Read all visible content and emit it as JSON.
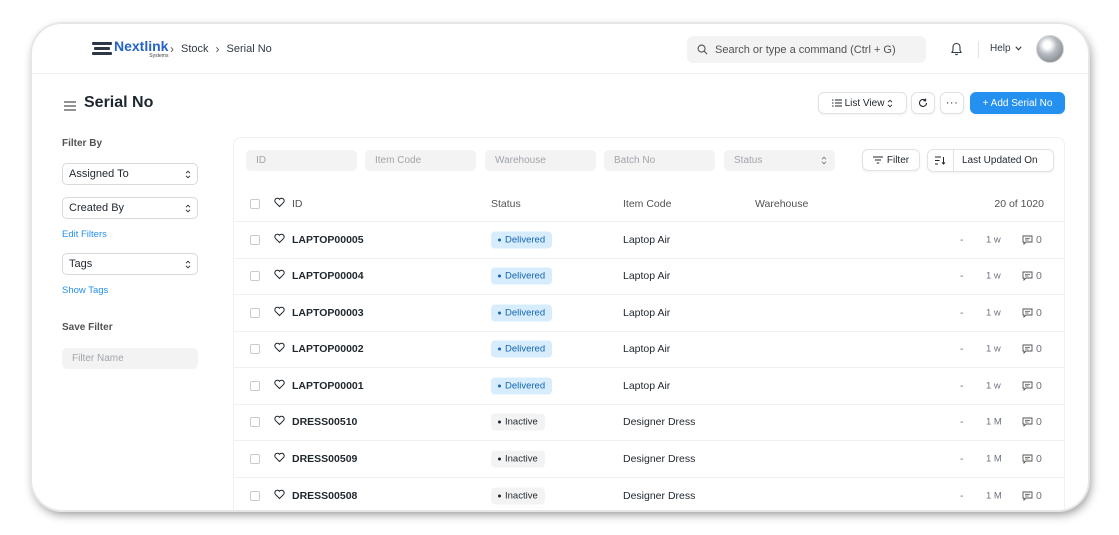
{
  "navbar": {
    "logo_text": "Nextlink",
    "logo_sub": "Systems",
    "breadcrumbs": [
      "Stock",
      "Serial No"
    ],
    "search_placeholder": "Search or type a command (Ctrl + G)",
    "help_label": "Help",
    "icons": {
      "search": "search-icon",
      "bell": "bell-icon",
      "chevron": "chevron-down-icon"
    }
  },
  "page": {
    "title": "Serial No",
    "list_view_label": "List View",
    "more_label": "···",
    "add_label": "+ Add Serial No",
    "accent_color": "#2490ef"
  },
  "sidebar": {
    "filter_by_label": "Filter By",
    "assigned_to": "Assigned To",
    "created_by": "Created By",
    "edit_filters": "Edit Filters",
    "tags": "Tags",
    "show_tags": "Show Tags",
    "save_filter_label": "Save Filter",
    "filter_name_placeholder": "Filter Name"
  },
  "filters": {
    "id_placeholder": "ID",
    "item_code_placeholder": "Item Code",
    "warehouse_placeholder": "Warehouse",
    "batch_no_placeholder": "Batch No",
    "status_placeholder": "Status",
    "filter_label": "Filter",
    "sort_label": "Last Updated On"
  },
  "list": {
    "columns": {
      "id": "ID",
      "status": "Status",
      "item_code": "Item Code",
      "warehouse": "Warehouse"
    },
    "count": "20 of 1020",
    "rows": [
      {
        "id": "LAPTOP00005",
        "status": "Delivered",
        "item_code": "Laptop Air",
        "dash": "-",
        "age": "1 w",
        "comments": "0"
      },
      {
        "id": "LAPTOP00004",
        "status": "Delivered",
        "item_code": "Laptop Air",
        "dash": "-",
        "age": "1 w",
        "comments": "0"
      },
      {
        "id": "LAPTOP00003",
        "status": "Delivered",
        "item_code": "Laptop Air",
        "dash": "-",
        "age": "1 w",
        "comments": "0"
      },
      {
        "id": "LAPTOP00002",
        "status": "Delivered",
        "item_code": "Laptop Air",
        "dash": "-",
        "age": "1 w",
        "comments": "0"
      },
      {
        "id": "LAPTOP00001",
        "status": "Delivered",
        "item_code": "Laptop Air",
        "dash": "-",
        "age": "1 w",
        "comments": "0"
      },
      {
        "id": "DRESS00510",
        "status": "Inactive",
        "item_code": "Designer Dress",
        "dash": "-",
        "age": "1 M",
        "comments": "0"
      },
      {
        "id": "DRESS00509",
        "status": "Inactive",
        "item_code": "Designer Dress",
        "dash": "-",
        "age": "1 M",
        "comments": "0"
      },
      {
        "id": "DRESS00508",
        "status": "Inactive",
        "item_code": "Designer Dress",
        "dash": "-",
        "age": "1 M",
        "comments": "0"
      }
    ]
  }
}
